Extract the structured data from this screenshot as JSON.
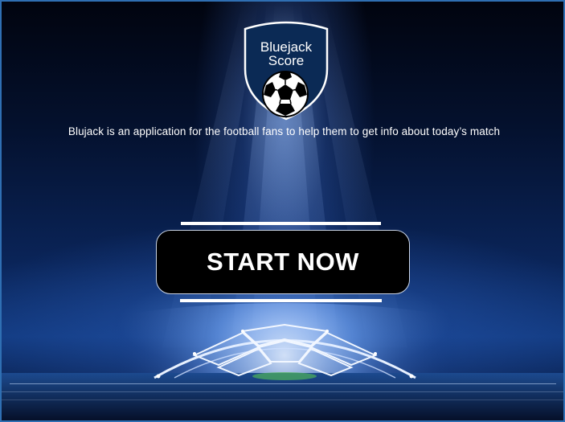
{
  "app": {
    "logo_text_line1": "Bluejack",
    "logo_text_line2": "Score",
    "tagline": "Blujack is an application for the football fans to help them to get info about today’s match",
    "start_button_label": "START NOW"
  },
  "colors": {
    "window_border": "#2f6fb3",
    "button_bg": "#000000",
    "button_text": "#ffffff",
    "shield_fill": "#0b2a55",
    "accent_light": "#bcd6ff"
  },
  "icons": {
    "logo": "soccer-ball-shield-icon"
  }
}
